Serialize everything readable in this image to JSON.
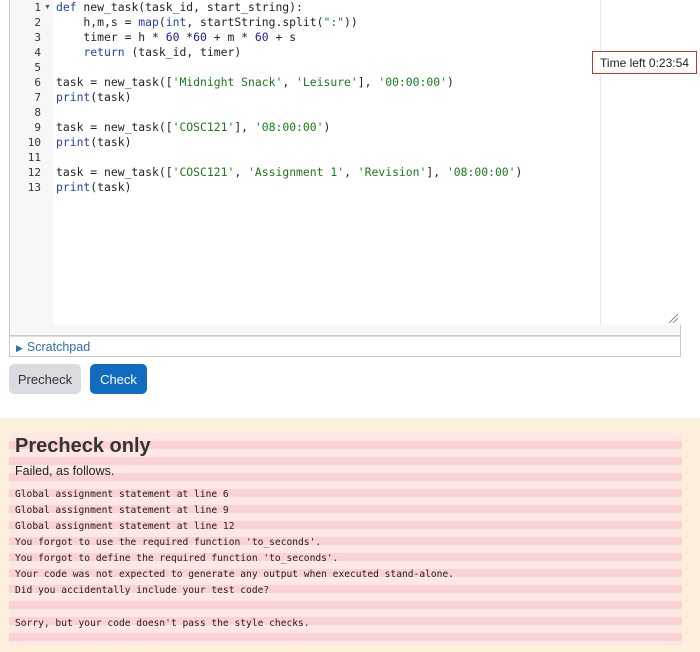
{
  "editor": {
    "line_numbers": [
      "1",
      "2",
      "3",
      "4",
      "5",
      "6",
      "7",
      "8",
      "9",
      "10",
      "11",
      "12",
      "13"
    ],
    "code_lines": [
      "def new_task(task_id, start_string):",
      "    h,m,s = map(int, startString.split(\":\"))",
      "    timer = h * 60 *60 + m * 60 + s",
      "    return (task_id, timer)",
      "",
      "task = new_task(['Midnight Snack', 'Leisure'], '00:00:00')",
      "print(task)",
      "",
      "task = new_task(['COSC121'], '08:00:00')",
      "print(task)",
      "",
      "task = new_task(['COSC121', 'Assignment 1', 'Revision'], '08:00:00')",
      "print(task)"
    ],
    "scratchpad_label": "Scratchpad"
  },
  "timer": {
    "label": "Time left 0:23:54"
  },
  "actions": {
    "precheck_label": "Precheck",
    "check_label": "Check"
  },
  "feedback": {
    "title": "Precheck only",
    "subtitle": "Failed, as follows.",
    "lines": [
      "Global assignment statement at line 6",
      "Global assignment statement at line 9",
      "Global assignment statement at line 12",
      "You forgot to use the required function 'to_seconds'.",
      "You forgot to define the required function 'to_seconds'.",
      "Your code was not expected to generate any output when executed stand-alone.",
      "Did you accidentally include your test code?",
      "",
      "Sorry, but your code doesn't pass the style checks."
    ]
  },
  "colors": {
    "accent": "#0f6cbf",
    "timer_border": "#c0392b",
    "feedback_bg": "#fcefdc",
    "feedback_stripe": "#fbd3d6"
  }
}
